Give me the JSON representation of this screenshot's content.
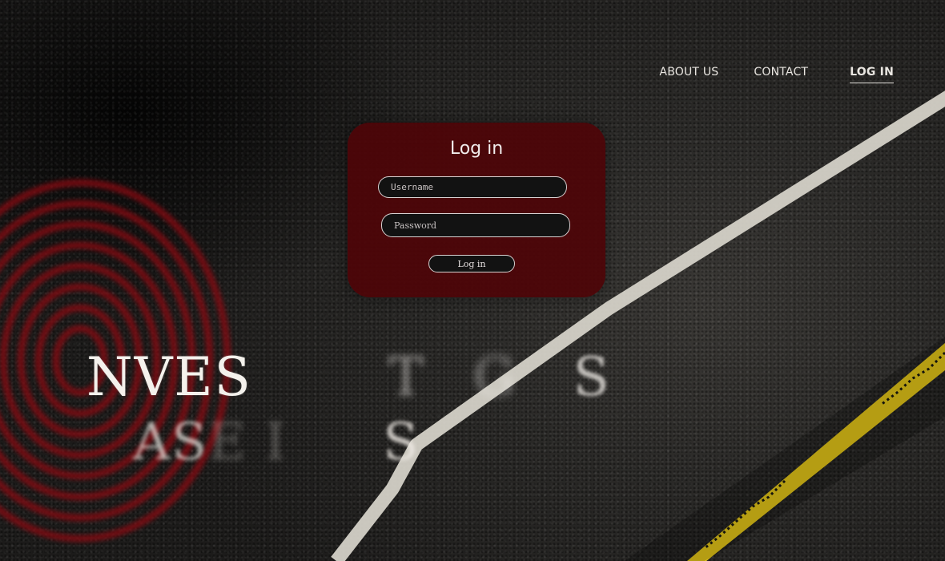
{
  "nav": {
    "about_label": "ABOUT US",
    "contact_label": "CONTACT",
    "login_label": "LOG IN"
  },
  "login_card": {
    "title": "Log in",
    "username_placeholder": "Username",
    "password_placeholder": "Password",
    "submit_label": "Log in"
  },
  "hero": {
    "line1_main": "NVES",
    "line1_ghost1": "T",
    "line1_ghost2": "G",
    "line1_tail": "S",
    "line2_main": "AS",
    "line2_fade": "E  I",
    "line2_tail": "S"
  },
  "colors": {
    "card_background": "#4e0408",
    "road_line": "#d9d6cc",
    "caution_tape": "#f2d21a",
    "fingerprint": "#8a0a12",
    "nav_text": "#e9e6e1"
  }
}
